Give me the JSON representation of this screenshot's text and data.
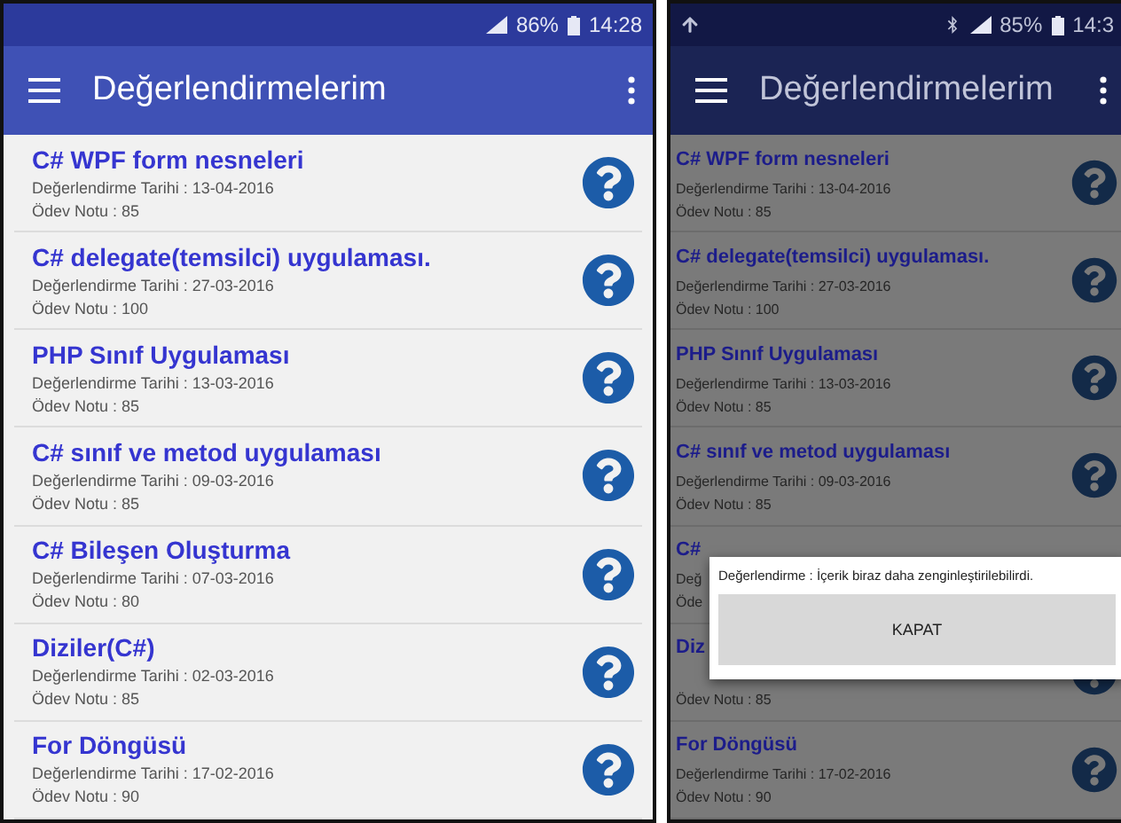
{
  "phones": [
    {
      "dimmed": false,
      "status_bar": {
        "upload": false,
        "bluetooth": false,
        "battery": "86%",
        "time": "14:28"
      },
      "app_bar": {
        "title": "Değerlendirmelerim"
      },
      "rows": [
        {
          "title": "C# WPF form nesneleri",
          "date": "Değerlendirme Tarihi : 13-04-2016",
          "grade": "Ödev Notu : 85",
          "icon": true
        },
        {
          "title": "C# delegate(temsilci) uygulaması.",
          "date": "Değerlendirme Tarihi : 27-03-2016",
          "grade": "Ödev Notu : 100",
          "icon": true
        },
        {
          "title": "PHP Sınıf Uygulaması",
          "date": "Değerlendirme Tarihi : 13-03-2016",
          "grade": "Ödev Notu : 85",
          "icon": true
        },
        {
          "title": "C# sınıf ve metod uygulaması",
          "date": "Değerlendirme Tarihi : 09-03-2016",
          "grade": "Ödev Notu : 85",
          "icon": true
        },
        {
          "title": "C# Bileşen Oluşturma",
          "date": "Değerlendirme Tarihi : 07-03-2016",
          "grade": "Ödev Notu : 80",
          "icon": true
        },
        {
          "title": "Diziler(C#)",
          "date": "Değerlendirme Tarihi : 02-03-2016",
          "grade": "Ödev Notu : 85",
          "icon": true
        },
        {
          "title": "For Döngüsü",
          "date": "Değerlendirme Tarihi : 17-02-2016",
          "grade": "Ödev Notu : 90",
          "icon": true
        }
      ]
    },
    {
      "dimmed": true,
      "status_bar": {
        "upload": true,
        "bluetooth": true,
        "battery": "85%",
        "time": "14:3"
      },
      "app_bar": {
        "title": "Değerlendirmelerim"
      },
      "rows": [
        {
          "title": "C# WPF form nesneleri",
          "date": "Değerlendirme Tarihi : 13-04-2016",
          "grade": "Ödev Notu : 85",
          "icon": true
        },
        {
          "title": "C# delegate(temsilci) uygulaması.",
          "date": "Değerlendirme Tarihi : 27-03-2016",
          "grade": "Ödev Notu : 100",
          "icon": true
        },
        {
          "title": "PHP Sınıf Uygulaması",
          "date": "Değerlendirme Tarihi : 13-03-2016",
          "grade": "Ödev Notu : 85",
          "icon": true
        },
        {
          "title": "C# sınıf ve metod uygulaması",
          "date": "Değerlendirme Tarihi : 09-03-2016",
          "grade": "Ödev Notu : 85",
          "icon": true
        },
        {
          "title": "C#",
          "date": "Değ",
          "grade": "Öde",
          "icon": false
        },
        {
          "title": "Diz",
          "grade": "Ödev Notu : 85",
          "icon": true
        },
        {
          "title": "For Döngüsü",
          "date": "Değerlendirme Tarihi : 17-02-2016",
          "grade": "Ödev Notu : 90",
          "icon": true
        }
      ],
      "dialog": {
        "message": "Değerlendirme : İçerik biraz daha zenginleştirilebilirdi.",
        "button": "KAPAT"
      }
    }
  ]
}
